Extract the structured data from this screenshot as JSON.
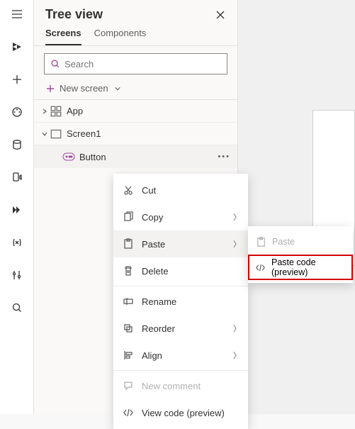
{
  "panel": {
    "title": "Tree view",
    "tabs": {
      "screens": "Screens",
      "components": "Components"
    },
    "search_placeholder": "Search",
    "new_screen": "New screen"
  },
  "tree": {
    "app": "App",
    "screen1": "Screen1",
    "button": "Button"
  },
  "context_menu": {
    "cut": "Cut",
    "copy": "Copy",
    "paste": "Paste",
    "delete": "Delete",
    "rename": "Rename",
    "reorder": "Reorder",
    "align": "Align",
    "new_comment": "New comment",
    "view_code": "View code (preview)"
  },
  "sub_menu": {
    "paste": "Paste",
    "paste_code": "Paste code (preview)"
  },
  "rail_icons": [
    "hamburger",
    "layers",
    "plus",
    "palette",
    "database",
    "mobile-audio",
    "double-chevron",
    "variable",
    "sliders",
    "search"
  ]
}
